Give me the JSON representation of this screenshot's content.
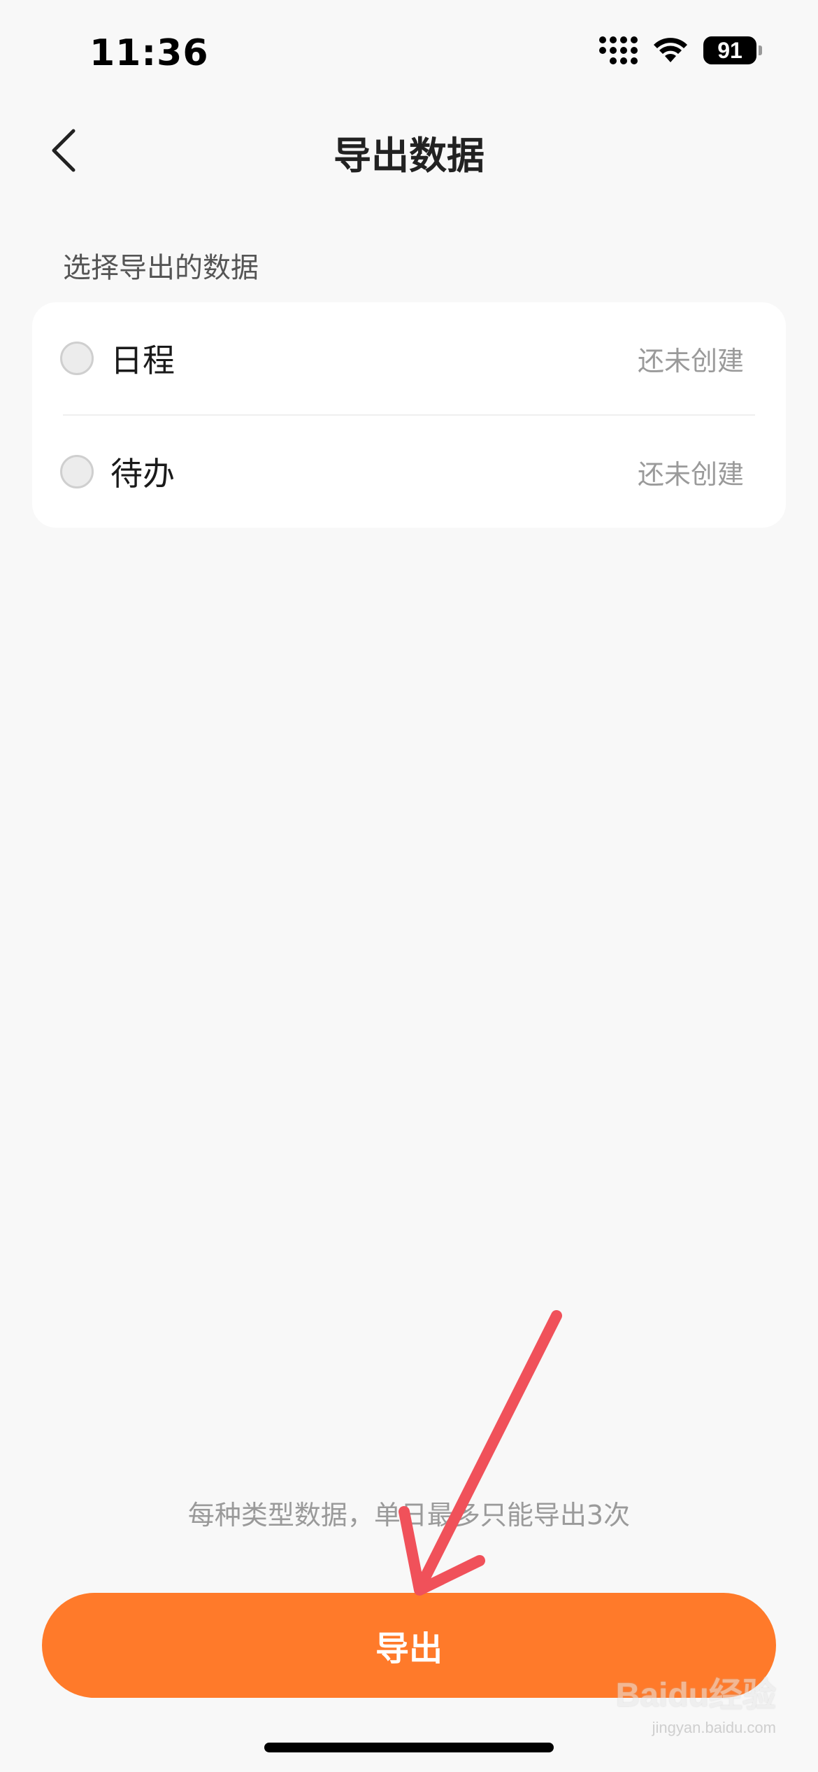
{
  "status_bar": {
    "time": "11:36",
    "battery": "91",
    "icons": [
      "signal-icon",
      "wifi-icon",
      "battery-icon"
    ]
  },
  "nav": {
    "title": "导出数据",
    "back_icon": "chevron-left-icon"
  },
  "section": {
    "label": "选择导出的数据"
  },
  "options": [
    {
      "label": "日程",
      "status": "还未创建",
      "selected": false
    },
    {
      "label": "待办",
      "status": "还未创建",
      "selected": false
    }
  ],
  "notice": "每种类型数据，单日最多只能导出3次",
  "export_button": {
    "label": "导出"
  },
  "watermark": {
    "brand": "Baidu经验",
    "sub": "jingyan.baidu.com"
  },
  "colors": {
    "accent": "#ff7a2a",
    "background": "#f8f8f8",
    "card": "#ffffff",
    "annotation": "#f0515a"
  }
}
